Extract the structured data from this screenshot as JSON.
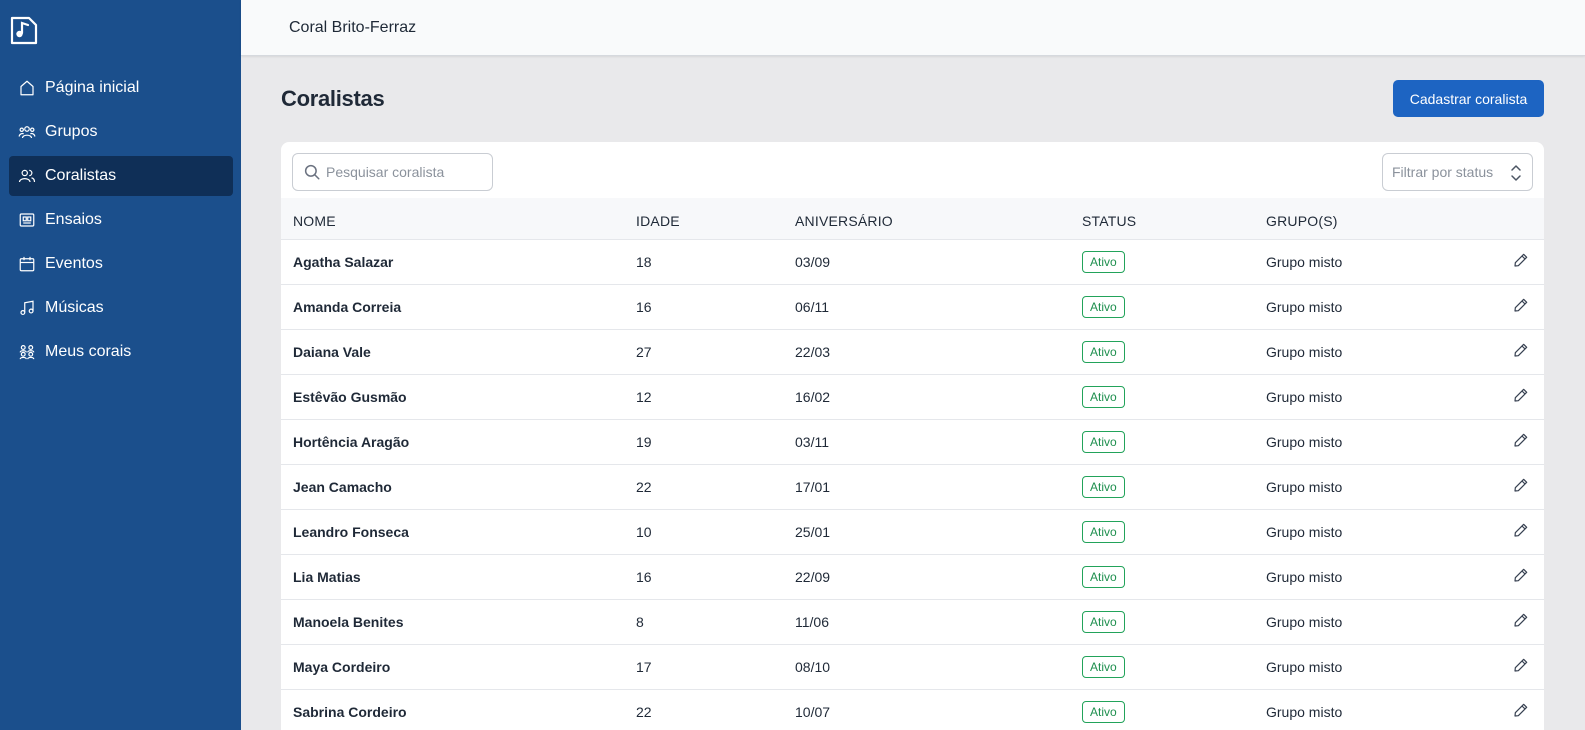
{
  "app": {
    "choir_name": "Coral Brito-Ferraz"
  },
  "sidebar": {
    "items": [
      {
        "label": "Página inicial",
        "icon": "home-icon",
        "active": false
      },
      {
        "label": "Grupos",
        "icon": "groups-icon",
        "active": false
      },
      {
        "label": "Coralistas",
        "icon": "users-icon",
        "active": true
      },
      {
        "label": "Ensaios",
        "icon": "rehearsal-icon",
        "active": false
      },
      {
        "label": "Eventos",
        "icon": "calendar-icon",
        "active": false
      },
      {
        "label": "Músicas",
        "icon": "music-note-icon",
        "active": false
      },
      {
        "label": "Meus corais",
        "icon": "choirs-icon",
        "active": false
      }
    ]
  },
  "main": {
    "title": "Coralistas",
    "add_button": "Cadastrar coralista",
    "search_placeholder": "Pesquisar coralista",
    "filter_placeholder": "Filtrar por status",
    "columns": [
      "NOME",
      "IDADE",
      "ANIVERSÁRIO",
      "STATUS",
      "GRUPO(S)"
    ],
    "rows": [
      {
        "name": "Agatha Salazar",
        "age": "18",
        "birthday": "03/09",
        "status": "Ativo",
        "group": "Grupo misto"
      },
      {
        "name": "Amanda Correia",
        "age": "16",
        "birthday": "06/11",
        "status": "Ativo",
        "group": "Grupo misto"
      },
      {
        "name": "Daiana Vale",
        "age": "27",
        "birthday": "22/03",
        "status": "Ativo",
        "group": "Grupo misto"
      },
      {
        "name": "Estêvão Gusmão",
        "age": "12",
        "birthday": "16/02",
        "status": "Ativo",
        "group": "Grupo misto"
      },
      {
        "name": "Hortência Aragão",
        "age": "19",
        "birthday": "03/11",
        "status": "Ativo",
        "group": "Grupo misto"
      },
      {
        "name": "Jean Camacho",
        "age": "22",
        "birthday": "17/01",
        "status": "Ativo",
        "group": "Grupo misto"
      },
      {
        "name": "Leandro Fonseca",
        "age": "10",
        "birthday": "25/01",
        "status": "Ativo",
        "group": "Grupo misto"
      },
      {
        "name": "Lia Matias",
        "age": "16",
        "birthday": "22/09",
        "status": "Ativo",
        "group": "Grupo misto"
      },
      {
        "name": "Manoela Benites",
        "age": "8",
        "birthday": "11/06",
        "status": "Ativo",
        "group": "Grupo misto"
      },
      {
        "name": "Maya Cordeiro",
        "age": "17",
        "birthday": "08/10",
        "status": "Ativo",
        "group": "Grupo misto"
      },
      {
        "name": "Sabrina Cordeiro",
        "age": "22",
        "birthday": "10/07",
        "status": "Ativo",
        "group": "Grupo misto"
      }
    ]
  },
  "colors": {
    "sidebar": "#1b4f8c",
    "sidebar_active": "#0f2f57",
    "primary": "#1d64c2",
    "status_active": "#22a35a"
  }
}
